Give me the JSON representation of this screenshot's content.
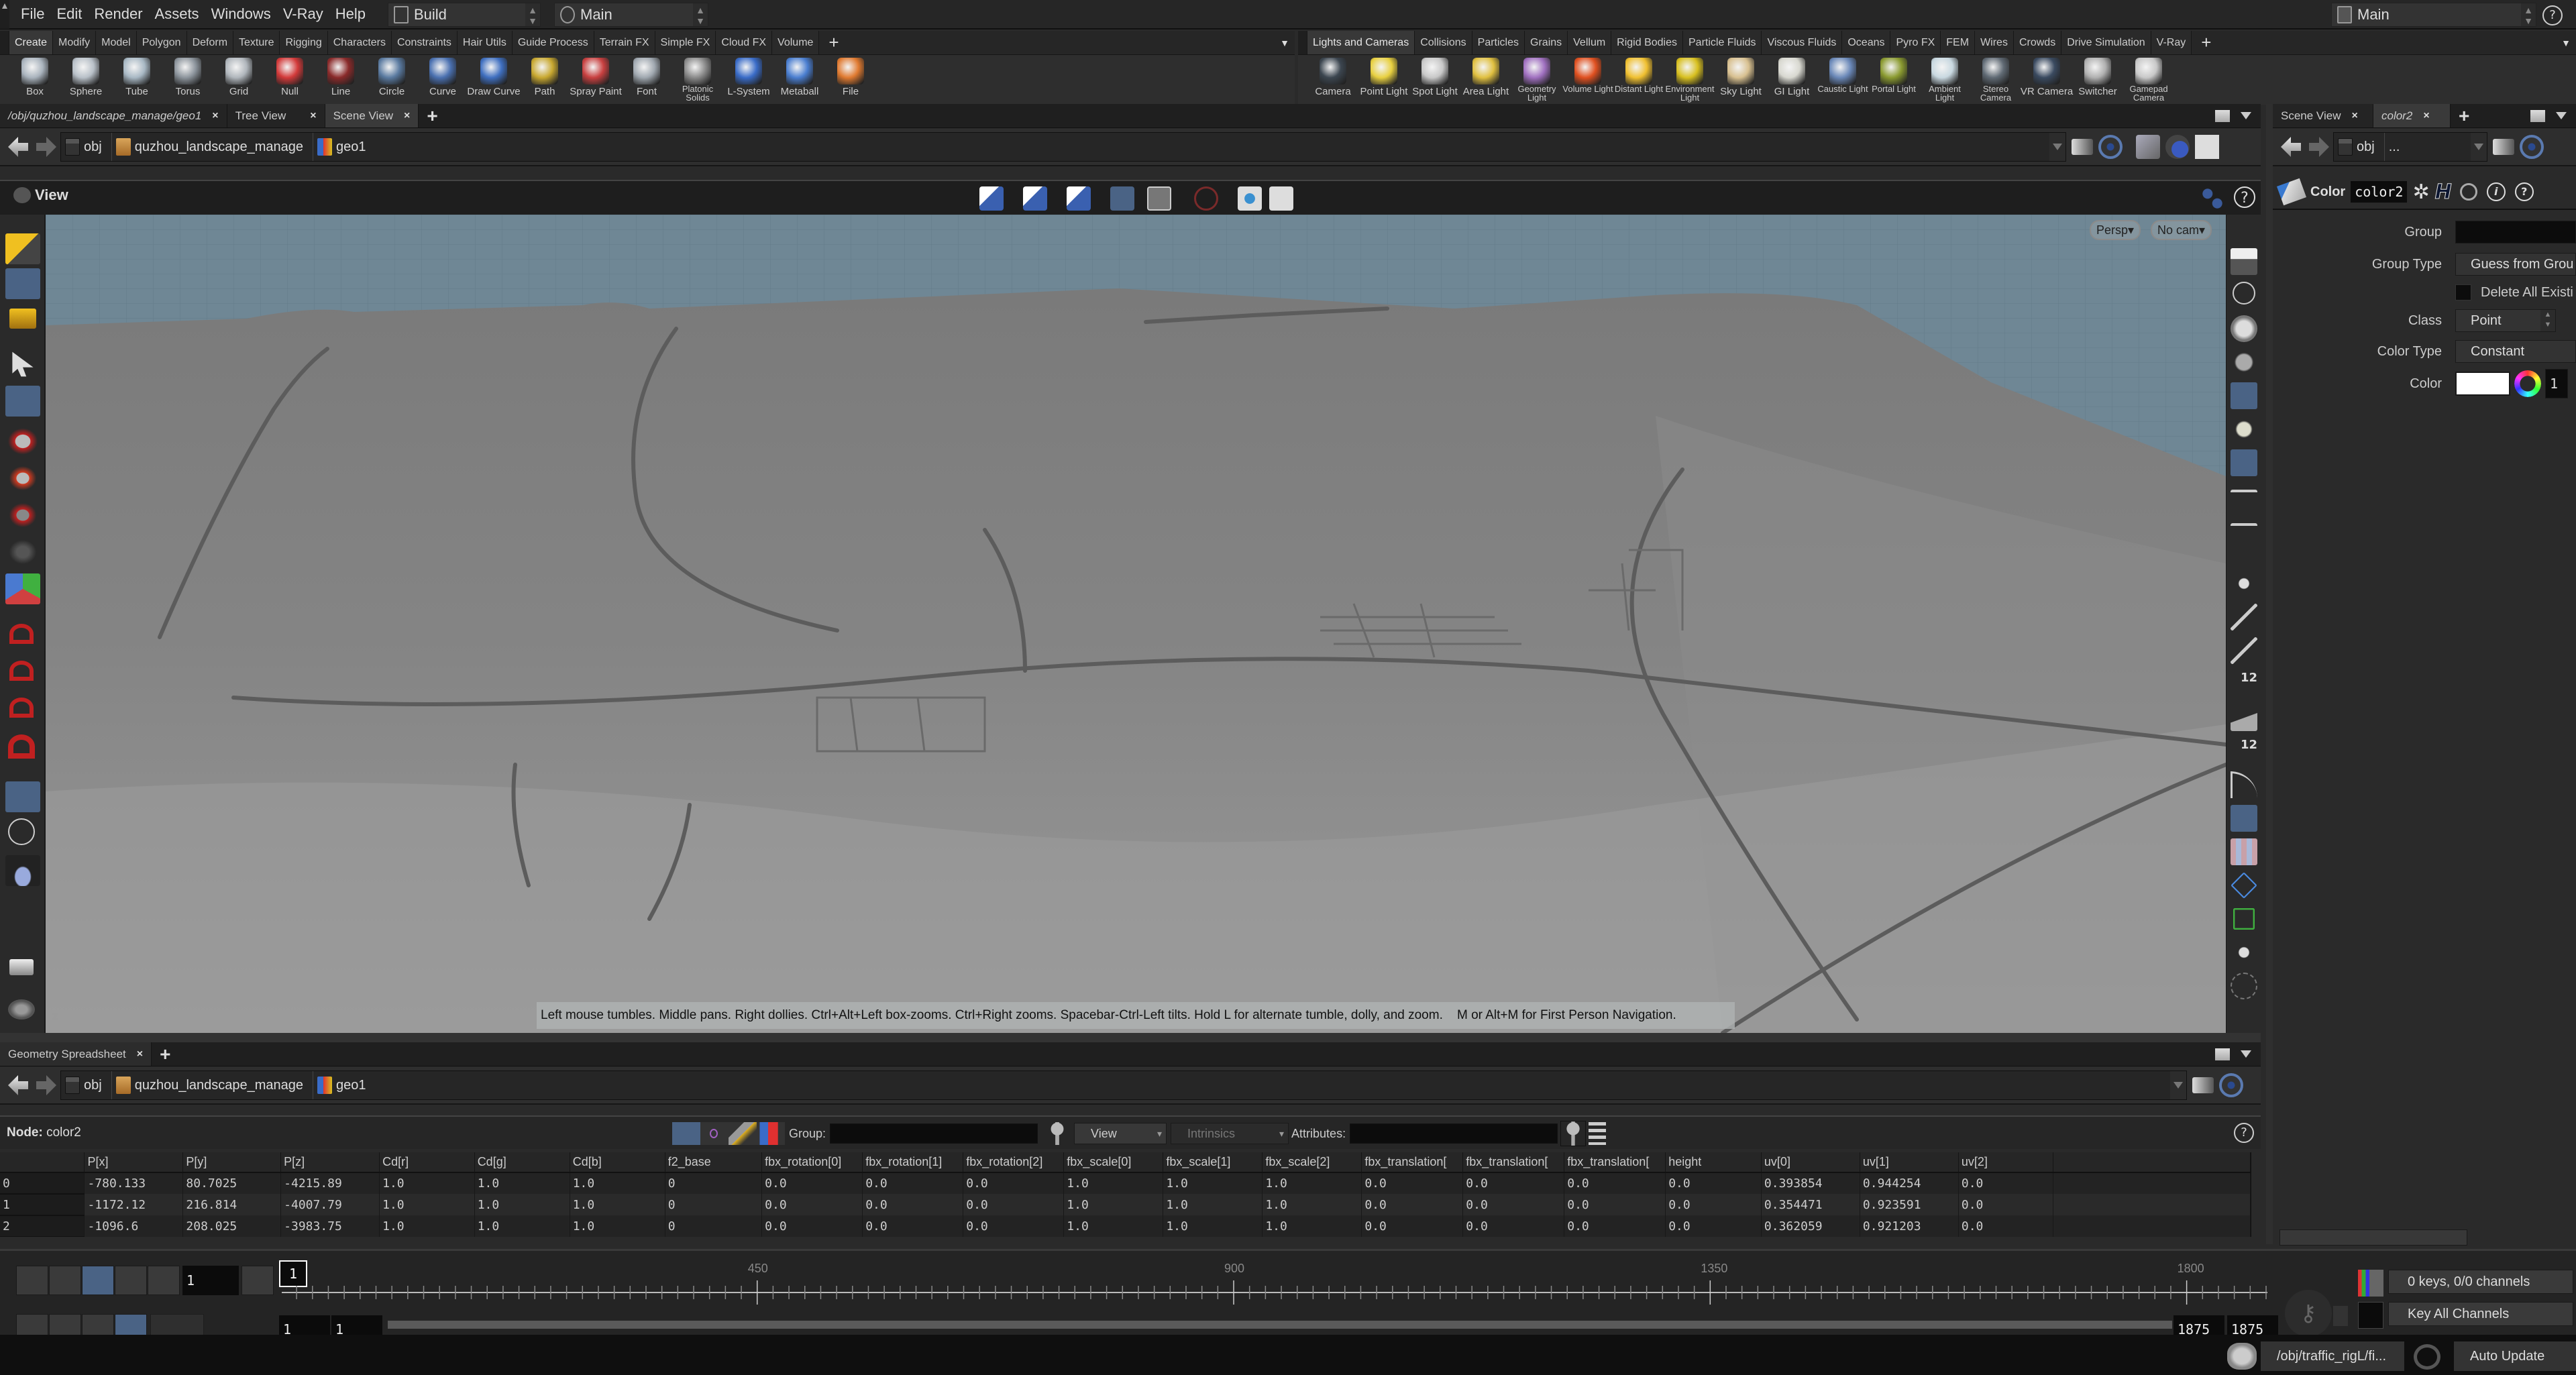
{
  "menubar": {
    "items": [
      "File",
      "Edit",
      "Render",
      "Assets",
      "Windows",
      "V-Ray",
      "Help"
    ],
    "desktop": "Build",
    "network": "Main",
    "right_desktop": "Main"
  },
  "shelf_left": {
    "tabs": [
      "Create",
      "Modify",
      "Model",
      "Polygon",
      "Deform",
      "Texture",
      "Rigging",
      "Characters",
      "Constraints",
      "Hair Utils",
      "Guide Process",
      "Terrain FX",
      "Simple FX",
      "Cloud FX",
      "Volume"
    ],
    "active_tab": "Create",
    "tools": [
      {
        "label": "Box",
        "icon": "box-icon",
        "color": "#a9b3bd"
      },
      {
        "label": "Sphere",
        "icon": "sphere-icon",
        "color": "#b8c0c8"
      },
      {
        "label": "Tube",
        "icon": "tube-icon",
        "color": "#a8b8c4"
      },
      {
        "label": "Torus",
        "icon": "torus-icon",
        "color": "#8c949c"
      },
      {
        "label": "Grid",
        "icon": "grid-icon",
        "color": "#b0b6bc"
      },
      {
        "label": "Null",
        "icon": "null-icon",
        "color": "#d33a3a"
      },
      {
        "label": "Line",
        "icon": "line-icon",
        "color": "#8a2a2a"
      },
      {
        "label": "Circle",
        "icon": "circle-icon",
        "color": "#5a7aa0"
      },
      {
        "label": "Curve",
        "icon": "curve-icon",
        "color": "#4a70b0"
      },
      {
        "label": "Draw Curve",
        "icon": "draw-curve-icon",
        "color": "#3f6fc0"
      },
      {
        "label": "Path",
        "icon": "path-icon",
        "color": "#c8a830"
      },
      {
        "label": "Spray Paint",
        "icon": "spray-paint-icon",
        "color": "#c84040"
      },
      {
        "label": "Font",
        "icon": "font-icon",
        "color": "#a0a8b0"
      },
      {
        "label": "Platonic Solids",
        "icon": "platonic-solids-icon",
        "color": "#8a8a8a"
      },
      {
        "label": "L-System",
        "icon": "l-system-icon",
        "color": "#3a6cc8"
      },
      {
        "label": "Metaball",
        "icon": "metaball-icon",
        "color": "#4a7ed0"
      },
      {
        "label": "File",
        "icon": "file-icon",
        "color": "#e07a30"
      }
    ]
  },
  "shelf_right": {
    "tabs": [
      "Lights and Cameras",
      "Collisions",
      "Particles",
      "Grains",
      "Vellum",
      "Rigid Bodies",
      "Particle Fluids",
      "Viscous Fluids",
      "Oceans",
      "Pyro FX",
      "FEM",
      "Wires",
      "Crowds",
      "Drive Simulation",
      "V-Ray"
    ],
    "active_tab": "Lights and Cameras",
    "tools": [
      {
        "label": "Camera",
        "icon": "camera-icon",
        "color": "#3c4650"
      },
      {
        "label": "Point Light",
        "icon": "point-light-icon",
        "color": "#e8d040"
      },
      {
        "label": "Spot Light",
        "icon": "spot-light-icon",
        "color": "#c8c8c8"
      },
      {
        "label": "Area Light",
        "icon": "area-light-icon",
        "color": "#e0c040"
      },
      {
        "label": "Geometry Light",
        "icon": "geometry-light-icon",
        "color": "#a070c0"
      },
      {
        "label": "Volume Light",
        "icon": "volume-light-icon",
        "color": "#e05020"
      },
      {
        "label": "Distant Light",
        "icon": "distant-light-icon",
        "color": "#f0c030"
      },
      {
        "label": "Environment Light",
        "icon": "environment-light-icon",
        "color": "#d8c020"
      },
      {
        "label": "Sky Light",
        "icon": "sky-light-icon",
        "color": "#d8c090"
      },
      {
        "label": "GI Light",
        "icon": "gi-light-icon",
        "color": "#d8d8d0"
      },
      {
        "label": "Caustic Light",
        "icon": "caustic-light-icon",
        "color": "#6a88b8"
      },
      {
        "label": "Portal Light",
        "icon": "portal-light-icon",
        "color": "#8a9a30"
      },
      {
        "label": "Ambient Light",
        "icon": "ambient-light-icon",
        "color": "#c8d8e0"
      },
      {
        "label": "Stereo Camera",
        "icon": "stereo-camera-icon",
        "color": "#606a74"
      },
      {
        "label": "VR Camera",
        "icon": "vr-camera-icon",
        "color": "#3a4a60"
      },
      {
        "label": "Switcher",
        "icon": "switcher-icon",
        "color": "#b0b0b0"
      },
      {
        "label": "Gamepad Camera",
        "icon": "gamepad-camera-icon",
        "color": "#c8c8c8"
      }
    ]
  },
  "main_pane": {
    "tabs": [
      {
        "label": "/obj/quzhou_landscape_manage/geo1",
        "active": false
      },
      {
        "label": "Tree View",
        "active": false
      },
      {
        "label": "Scene View",
        "active": true
      }
    ],
    "path": [
      "obj",
      "quzhou_landscape_manage",
      "geo1"
    ],
    "view_title": "View",
    "camera_menu": "Persp",
    "cam_menu": "No cam",
    "hint": "Left mouse tumbles. Middle pans. Right dollies. Ctrl+Alt+Left box-zooms. Ctrl+Right zooms. Spacebar-Ctrl-Left tilts. Hold L for alternate tumble, dolly, and zoom.    M or Alt+M for First Person Navigation."
  },
  "spreadsheet": {
    "tab": "Geometry Spreadsheet",
    "path": [
      "obj",
      "quzhou_landscape_manage",
      "geo1"
    ],
    "node_label": "Node:",
    "node": "color2",
    "group_label": "Group:",
    "view_label": "View",
    "intrinsics_label": "Intrinsics",
    "attributes_label": "Attributes:",
    "columns": [
      "",
      "P[x]",
      "P[y]",
      "P[z]",
      "Cd[r]",
      "Cd[g]",
      "Cd[b]",
      "f2_base",
      "fbx_rotation[0]",
      "fbx_rotation[1]",
      "fbx_rotation[2]",
      "fbx_scale[0]",
      "fbx_scale[1]",
      "fbx_scale[2]",
      "fbx_translation[",
      "fbx_translation[",
      "fbx_translation[",
      "height",
      "uv[0]",
      "uv[1]",
      "uv[2]",
      ""
    ],
    "rows": [
      [
        "0",
        "-780.133",
        "80.7025",
        "-4215.89",
        "1.0",
        "1.0",
        "1.0",
        "0",
        "0.0",
        "0.0",
        "0.0",
        "1.0",
        "1.0",
        "1.0",
        "0.0",
        "0.0",
        "0.0",
        "0.0",
        "0.393854",
        "0.944254",
        "0.0",
        ""
      ],
      [
        "1",
        "-1172.12",
        "216.814",
        "-4007.79",
        "1.0",
        "1.0",
        "1.0",
        "0",
        "0.0",
        "0.0",
        "0.0",
        "1.0",
        "1.0",
        "1.0",
        "0.0",
        "0.0",
        "0.0",
        "0.0",
        "0.354471",
        "0.923591",
        "0.0",
        ""
      ],
      [
        "2",
        "-1096.6",
        "208.025",
        "-3983.75",
        "1.0",
        "1.0",
        "1.0",
        "0",
        "0.0",
        "0.0",
        "0.0",
        "1.0",
        "1.0",
        "1.0",
        "0.0",
        "0.0",
        "0.0",
        "0.0",
        "0.362059",
        "0.921203",
        "0.0",
        ""
      ]
    ]
  },
  "param_pane": {
    "tabs": [
      {
        "label": "Scene View",
        "active": false
      },
      {
        "label": "color2",
        "active": true
      }
    ],
    "path": [
      "obj",
      "..."
    ],
    "node_type": "Color",
    "node_name": "color2",
    "params": {
      "group_label": "Group",
      "group_value": "",
      "group_type_label": "Group Type",
      "group_type_value": "Guess from Grou",
      "delete_label": "Delete All Existi",
      "class_label": "Class",
      "class_value": "Point",
      "color_type_label": "Color Type",
      "color_type_value": "Constant",
      "color_label": "Color",
      "color_value": "1",
      "color_swatch": "#ffffff"
    }
  },
  "timeline": {
    "current_frame": "1",
    "marker": "1",
    "ticks": [
      "450",
      "900",
      "1350",
      "1800"
    ],
    "start": "1",
    "start2": "1",
    "end": "1875",
    "end2": "1875",
    "keys_info": "0 keys, 0/0 channels",
    "key_mode": "Key All Channels",
    "frame_range": {
      "min": 1,
      "max": 1875
    }
  },
  "statusbar": {
    "context": "/obj/traffic_rigL/fi...",
    "update_mode": "Auto Update"
  },
  "colors": {
    "selection_blue": "#4a6385",
    "sky": "#6f8795",
    "terrain": "#868686"
  }
}
